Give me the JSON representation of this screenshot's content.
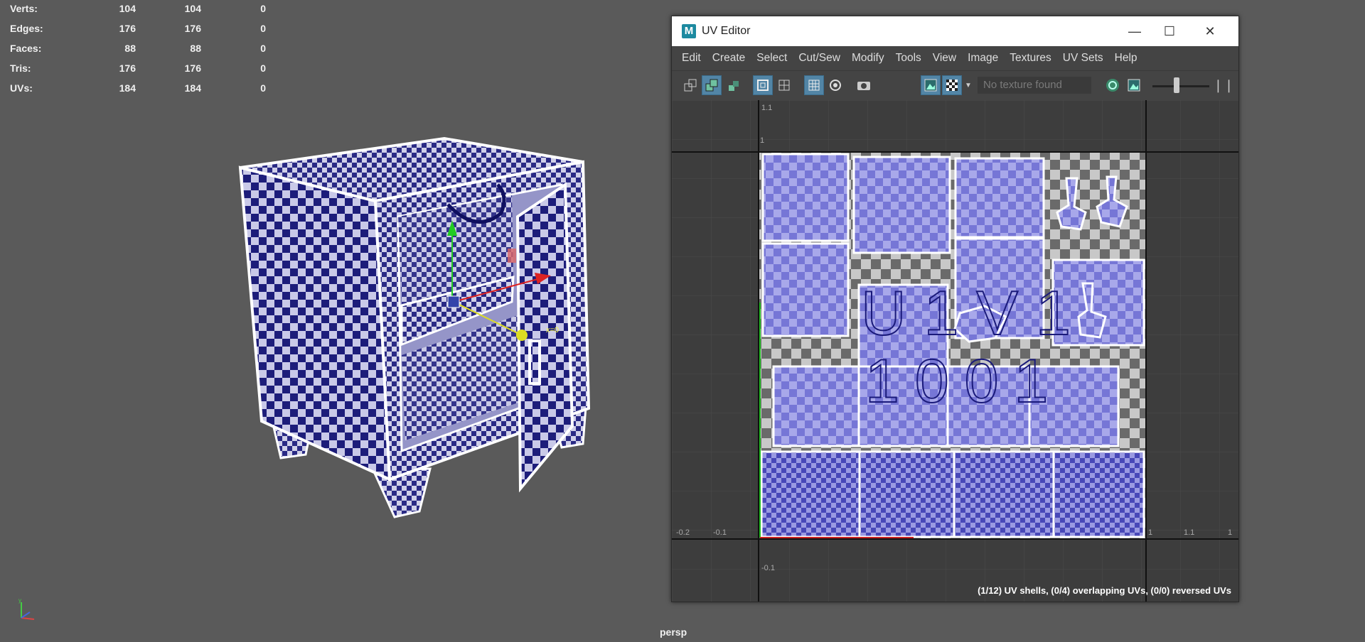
{
  "hud": {
    "rows": [
      {
        "label": "Verts:",
        "v1": "104",
        "v2": "104",
        "v3": "0"
      },
      {
        "label": "Edges:",
        "v1": "176",
        "v2": "176",
        "v3": "0"
      },
      {
        "label": "Faces:",
        "v1": "88",
        "v2": "88",
        "v3": "0"
      },
      {
        "label": "Tris:",
        "v1": "176",
        "v2": "176",
        "v3": "0"
      },
      {
        "label": "UVs:",
        "v1": "184",
        "v2": "184",
        "v3": "0"
      }
    ]
  },
  "viewport": {
    "camera_label": "persp",
    "gizmo_label": "x=0"
  },
  "uv_editor": {
    "app_icon": "M",
    "title": "UV Editor",
    "menus": [
      "Edit",
      "Create",
      "Select",
      "Cut/Sew",
      "Modify",
      "Tools",
      "View",
      "Image",
      "Textures",
      "UV Sets",
      "Help"
    ],
    "texture_field": "No texture found",
    "tile_text": {
      "line1": "U1V1",
      "line2": "1001"
    },
    "axis_labels": {
      "top": "1.1",
      "one_v": "1",
      "left_a": "-0.2",
      "left_b": "-0.1",
      "right_a": "1",
      "right_b": "1.1",
      "right_c": "1",
      "bottom": "-0.1"
    },
    "status": "(1/12) UV shells, (0/4) overlapping UVs, (0/0) reversed UVs"
  },
  "icons": [
    "minimize-icon",
    "maximize-icon",
    "close-icon",
    "axis-gizmo-icon"
  ],
  "colors": {
    "uv_shell_fill": "#7f7fe0",
    "checker_dark": "#1d1d7a",
    "checker_light": "#c9c9e8",
    "viewport_bg": "#5a5a5a"
  }
}
